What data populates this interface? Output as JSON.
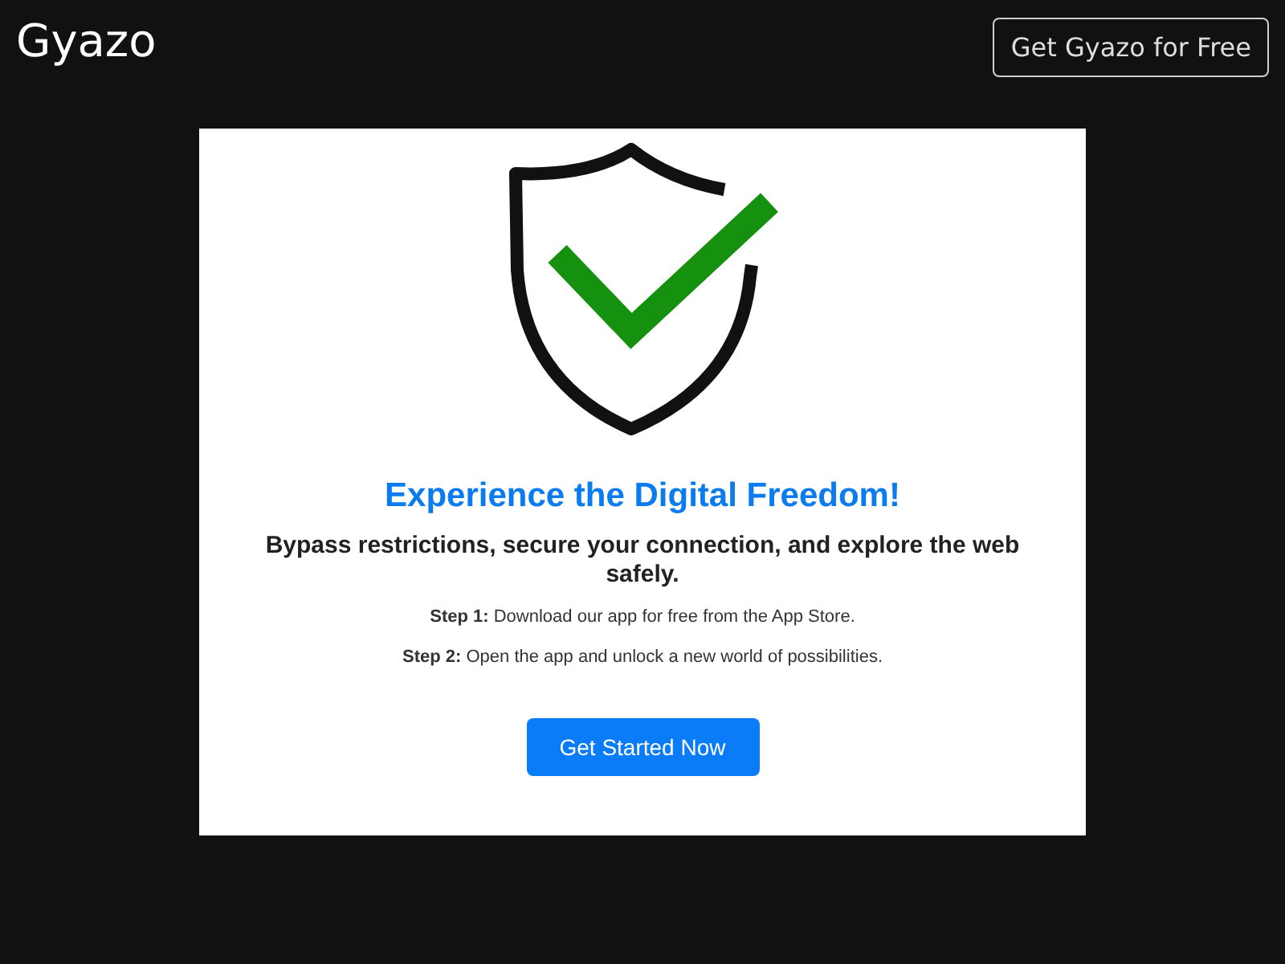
{
  "header": {
    "logo": "Gyazo",
    "cta_button": "Get Gyazo for Free"
  },
  "image": {
    "heading": "Experience the Digital Freedom!",
    "subheading": "Bypass restrictions, secure your connection, and explore the web safely.",
    "steps": [
      "**Step 1:** Download our app for free from the App Store.",
      "**Step 2:** Open the app and unlock a new world of possibilities."
    ],
    "button": "Get Started Now"
  }
}
